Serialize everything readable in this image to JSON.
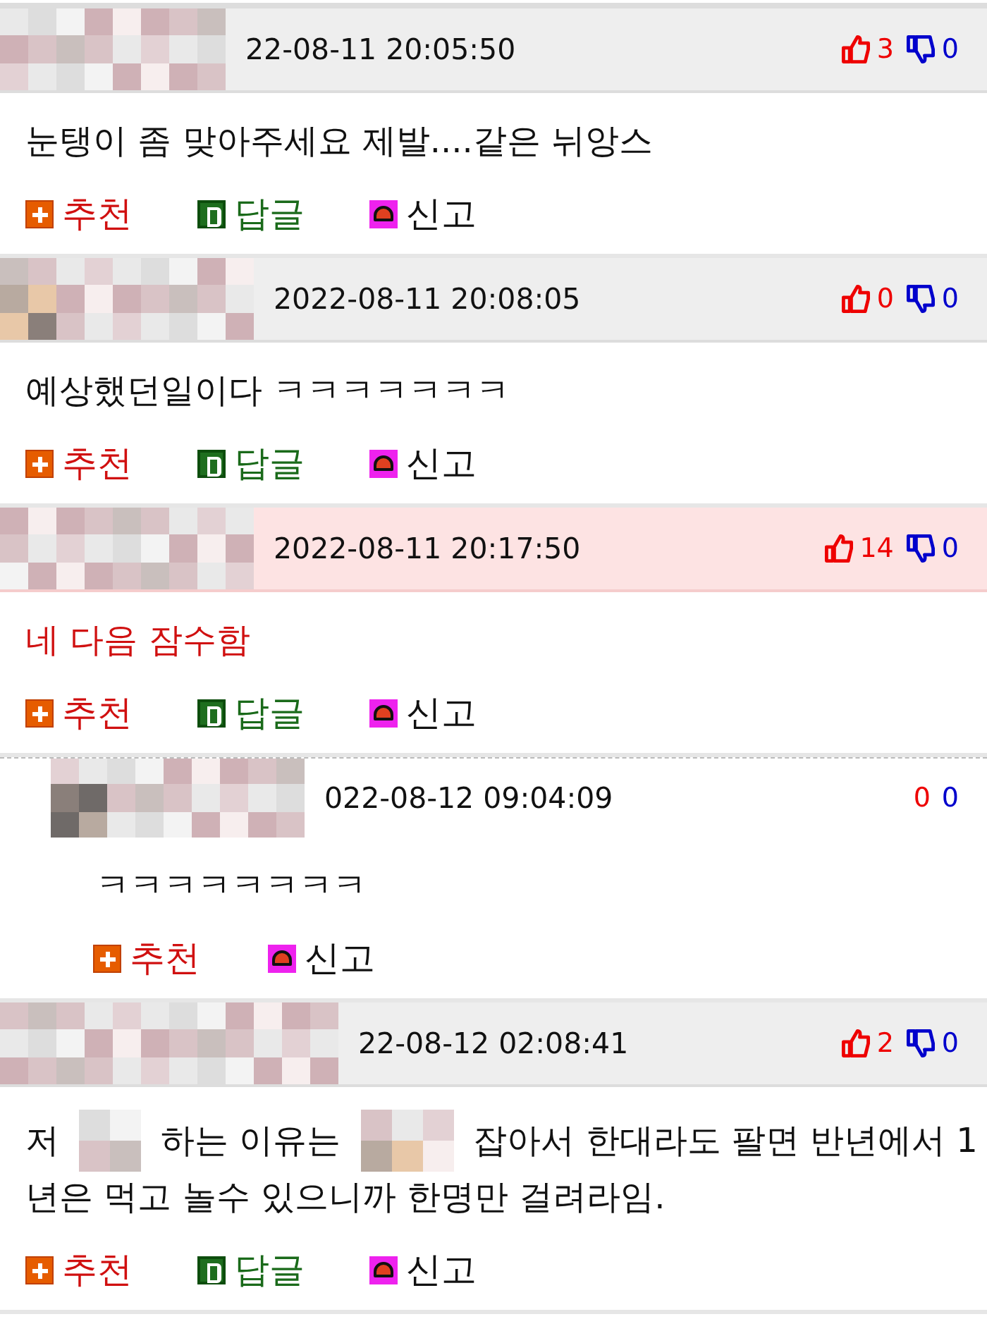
{
  "comments": [
    {
      "kind": "comment",
      "highlighted": false,
      "date": "22-08-11 20:05:50",
      "likes": "3",
      "dislikes": "0",
      "body": [
        [
          "눈탱이 좀 맞아주세요 제발....같은 뉘앙스"
        ]
      ],
      "actions": [
        {
          "kind": "recommend",
          "label": "추천"
        },
        {
          "kind": "reply",
          "label": "답글"
        },
        {
          "kind": "report",
          "label": "신고"
        }
      ]
    },
    {
      "kind": "comment",
      "highlighted": false,
      "date": "2022-08-11 20:08:05",
      "likes": "0",
      "dislikes": "0",
      "body": [
        [
          "예상했던일이다 ㅋㅋㅋㅋㅋㅋㅋ"
        ]
      ],
      "actions": [
        {
          "kind": "recommend",
          "label": "추천"
        },
        {
          "kind": "reply",
          "label": "답글"
        },
        {
          "kind": "report",
          "label": "신고"
        }
      ]
    },
    {
      "kind": "comment",
      "highlighted": true,
      "date": "2022-08-11 20:17:50",
      "likes": "14",
      "dislikes": "0",
      "body": [
        [
          "네 다음 잠수함"
        ]
      ],
      "actions": [
        {
          "kind": "recommend",
          "label": "추천"
        },
        {
          "kind": "reply",
          "label": "답글"
        },
        {
          "kind": "report",
          "label": "신고"
        }
      ]
    },
    {
      "kind": "reply",
      "highlighted": false,
      "date": "022-08-12 09:04:09",
      "likes": "0",
      "dislikes": "0",
      "body": [
        [
          "ㅋㅋㅋㅋㅋㅋㅋㅋ"
        ]
      ],
      "actions": [
        {
          "kind": "recommend",
          "label": "추천"
        },
        {
          "kind": "report",
          "label": "신고"
        }
      ]
    },
    {
      "kind": "comment",
      "highlighted": false,
      "date": "22-08-12 02:08:41",
      "likes": "2",
      "dislikes": "0",
      "body": [
        [
          "저",
          "하는 이유는",
          "잡아서 한대라도 팔면 반년에서 1"
        ],
        [
          "년은 먹고 놀수 있으니까 한명만 걸려라임."
        ]
      ],
      "actions": [
        {
          "kind": "recommend",
          "label": "추천"
        },
        {
          "kind": "reply",
          "label": "답글"
        },
        {
          "kind": "report",
          "label": "신고"
        }
      ]
    }
  ]
}
